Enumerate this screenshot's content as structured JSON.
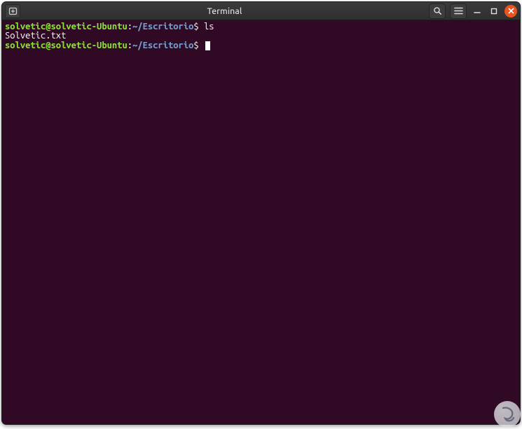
{
  "window": {
    "title": "Terminal"
  },
  "titlebar": {
    "newtab_icon": "new-tab-icon",
    "search_icon": "search-icon",
    "menu_icon": "hamburger-icon",
    "minimize_icon": "minimize-icon",
    "maximize_icon": "maximize-icon",
    "close_icon": "close-icon"
  },
  "terminal": {
    "lines": [
      {
        "user": "solvetic@solvetic-Ubuntu",
        "path": "~/Escritorio",
        "command": "ls"
      },
      {
        "output": "Solvetic.txt"
      },
      {
        "user": "solvetic@solvetic-Ubuntu",
        "path": "~/Escritorio",
        "command": "",
        "cursor": true
      }
    ],
    "prompt_sep": ":",
    "prompt_end": "$"
  },
  "colors": {
    "bg": "#300a24",
    "titlebar": "#343434",
    "prompt_user": "#8ae234",
    "prompt_path": "#729fcf",
    "text": "#ffffff",
    "close": "#e95420"
  }
}
